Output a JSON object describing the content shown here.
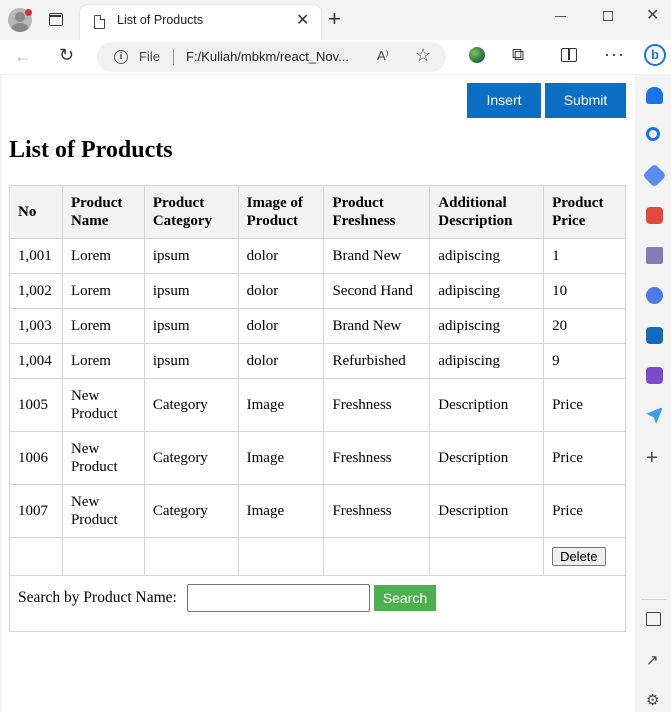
{
  "browser": {
    "tab_title": "List of Products",
    "address_prefix": "File",
    "url": "F:/Kuliah/mbkm/react_Nov...",
    "read_aloud": "A⁾"
  },
  "page": {
    "insert_label": "Insert",
    "submit_label": "Submit",
    "title": "List of Products"
  },
  "table": {
    "headers": [
      {
        "line1": "No",
        "line2": ""
      },
      {
        "line1": "Product",
        "line2": "Name"
      },
      {
        "line1": "Product",
        "line2": "Category"
      },
      {
        "line1": "Image of",
        "line2": "Product"
      },
      {
        "line1": "Product",
        "line2": "Freshness"
      },
      {
        "line1": "Additional",
        "line2": "Description"
      },
      {
        "line1": "Product",
        "line2": "Price"
      }
    ],
    "rows": [
      {
        "no": "1,001",
        "name_1": "Lorem",
        "name_2": "",
        "category": "ipsum",
        "image": "dolor",
        "freshness": "Brand New",
        "description": "adipiscing",
        "price": "1"
      },
      {
        "no": "1,002",
        "name_1": "Lorem",
        "name_2": "",
        "category": "ipsum",
        "image": "dolor",
        "freshness": "Second Hand",
        "description": "adipiscing",
        "price": "10"
      },
      {
        "no": "1,003",
        "name_1": "Lorem",
        "name_2": "",
        "category": "ipsum",
        "image": "dolor",
        "freshness": "Brand New",
        "description": "adipiscing",
        "price": "20"
      },
      {
        "no": "1,004",
        "name_1": "Lorem",
        "name_2": "",
        "category": "ipsum",
        "image": "dolor",
        "freshness": "Refurbished",
        "description": "adipiscing",
        "price": "9"
      },
      {
        "no": "1005",
        "name_1": "New",
        "name_2": "Product",
        "category": "Category",
        "image": "Image",
        "freshness": "Freshness",
        "description": "Description",
        "price": "Price"
      },
      {
        "no": "1006",
        "name_1": "New",
        "name_2": "Product",
        "category": "Category",
        "image": "Image",
        "freshness": "Freshness",
        "description": "Description",
        "price": "Price"
      },
      {
        "no": "1007",
        "name_1": "New",
        "name_2": "Product",
        "category": "Category",
        "image": "Image",
        "freshness": "Freshness",
        "description": "Description",
        "price": "Price"
      }
    ],
    "delete_label": "Delete"
  },
  "search": {
    "label": "Search by Product Name:",
    "value": "",
    "button_label": "Search"
  },
  "colors": {
    "primary_button": "#0b6ec5",
    "search_button": "#4caf50",
    "header_bg": "#f2f2f2"
  },
  "icons": {
    "profile": "profile-icon",
    "tabs": "tab-actions-icon",
    "page": "page-icon",
    "info": "info-icon",
    "favorite": "star-icon",
    "extensions": "puzzle-icon",
    "split": "split-screen-icon",
    "more": "more-icon",
    "copilot": "bing-icon"
  }
}
